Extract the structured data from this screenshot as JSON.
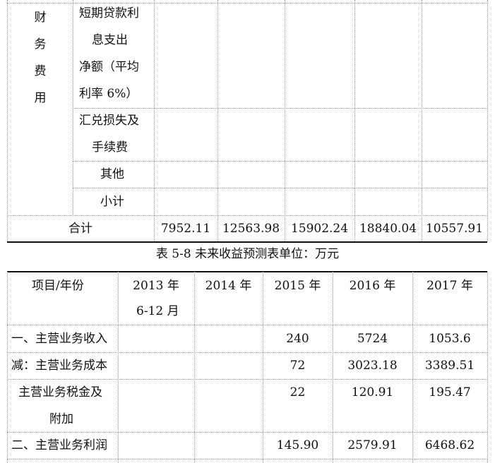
{
  "top_table": {
    "section_label_chars": [
      "财",
      "务",
      "费",
      "用"
    ],
    "row1_lines": [
      "短期贷款利",
      "息支出",
      "净额（平均",
      "利率 6%）"
    ],
    "row2_lines": [
      "汇兑损失及",
      "手续费"
    ],
    "row3_label": "其他",
    "row4_label": "小计",
    "total_label": "合计",
    "total_values": [
      "7952.11",
      "12563.98",
      "15902.24",
      "18840.04",
      "10557.91"
    ]
  },
  "caption": "表 5-8 未来收益预测表单位：万元",
  "bottom_table": {
    "header": {
      "item": "项目/年份",
      "y2013_line1": "2013 年",
      "y2013_line2": "6-12 月",
      "y2014": "2014 年",
      "y2015": "2015 年",
      "y2016": "2016 年",
      "y2017": "2017 年"
    },
    "rows": [
      {
        "label": "一、主营业务收入",
        "v2015": "240",
        "v2016": "5724",
        "v2017": "1053.6"
      },
      {
        "label": "减：主营业务成本",
        "v2015": "72",
        "v2016": "3023.18",
        "v2017": "3389.51"
      },
      {
        "label_line1": "主营业务税金及",
        "label_line2": "附加",
        "v2015": "22",
        "v2016": "120.91",
        "v2017": "195.47"
      },
      {
        "label": "二、主营业务利润",
        "v2015": "145.90",
        "v2016": "2579.91",
        "v2017": "6468.62"
      }
    ]
  }
}
